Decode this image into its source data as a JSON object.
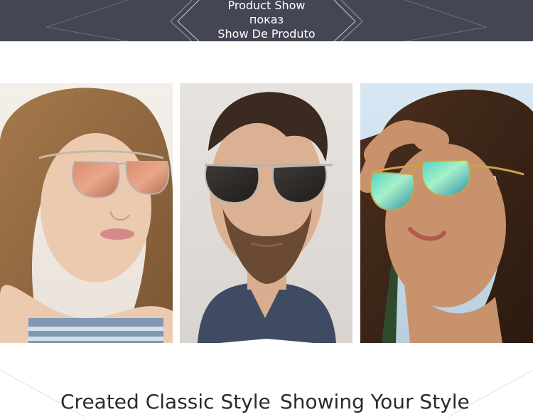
{
  "banner": {
    "line1": "Product Show",
    "line2": "показ",
    "line3": "Show De Produto"
  },
  "photos": [
    {
      "alt": "woman-wearing-rose-gold-mirror-aviator-sunglasses"
    },
    {
      "alt": "man-wearing-dark-aviator-sunglasses"
    },
    {
      "alt": "woman-wearing-green-mirror-aviator-sunglasses"
    }
  ],
  "caption": {
    "left": "Created Classic Style",
    "right": "Showing Your Style"
  },
  "colors": {
    "banner_bg": "#444654",
    "text_dark": "#2b2b2b"
  }
}
